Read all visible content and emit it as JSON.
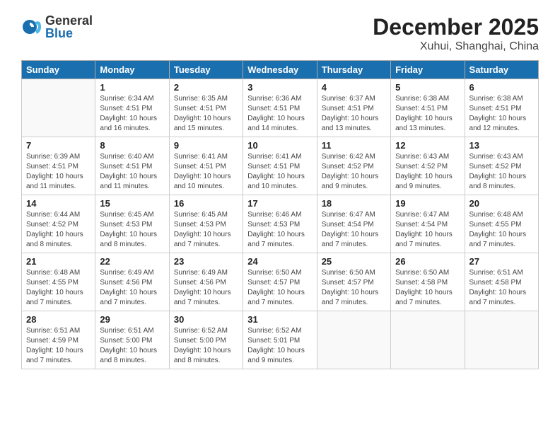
{
  "logo": {
    "general": "General",
    "blue": "Blue"
  },
  "title": "December 2025",
  "location": "Xuhui, Shanghai, China",
  "weekdays": [
    "Sunday",
    "Monday",
    "Tuesday",
    "Wednesday",
    "Thursday",
    "Friday",
    "Saturday"
  ],
  "weeks": [
    [
      {
        "day": "",
        "info": ""
      },
      {
        "day": "1",
        "info": "Sunrise: 6:34 AM\nSunset: 4:51 PM\nDaylight: 10 hours\nand 16 minutes."
      },
      {
        "day": "2",
        "info": "Sunrise: 6:35 AM\nSunset: 4:51 PM\nDaylight: 10 hours\nand 15 minutes."
      },
      {
        "day": "3",
        "info": "Sunrise: 6:36 AM\nSunset: 4:51 PM\nDaylight: 10 hours\nand 14 minutes."
      },
      {
        "day": "4",
        "info": "Sunrise: 6:37 AM\nSunset: 4:51 PM\nDaylight: 10 hours\nand 13 minutes."
      },
      {
        "day": "5",
        "info": "Sunrise: 6:38 AM\nSunset: 4:51 PM\nDaylight: 10 hours\nand 13 minutes."
      },
      {
        "day": "6",
        "info": "Sunrise: 6:38 AM\nSunset: 4:51 PM\nDaylight: 10 hours\nand 12 minutes."
      }
    ],
    [
      {
        "day": "7",
        "info": "Sunrise: 6:39 AM\nSunset: 4:51 PM\nDaylight: 10 hours\nand 11 minutes."
      },
      {
        "day": "8",
        "info": "Sunrise: 6:40 AM\nSunset: 4:51 PM\nDaylight: 10 hours\nand 11 minutes."
      },
      {
        "day": "9",
        "info": "Sunrise: 6:41 AM\nSunset: 4:51 PM\nDaylight: 10 hours\nand 10 minutes."
      },
      {
        "day": "10",
        "info": "Sunrise: 6:41 AM\nSunset: 4:51 PM\nDaylight: 10 hours\nand 10 minutes."
      },
      {
        "day": "11",
        "info": "Sunrise: 6:42 AM\nSunset: 4:52 PM\nDaylight: 10 hours\nand 9 minutes."
      },
      {
        "day": "12",
        "info": "Sunrise: 6:43 AM\nSunset: 4:52 PM\nDaylight: 10 hours\nand 9 minutes."
      },
      {
        "day": "13",
        "info": "Sunrise: 6:43 AM\nSunset: 4:52 PM\nDaylight: 10 hours\nand 8 minutes."
      }
    ],
    [
      {
        "day": "14",
        "info": "Sunrise: 6:44 AM\nSunset: 4:52 PM\nDaylight: 10 hours\nand 8 minutes."
      },
      {
        "day": "15",
        "info": "Sunrise: 6:45 AM\nSunset: 4:53 PM\nDaylight: 10 hours\nand 8 minutes."
      },
      {
        "day": "16",
        "info": "Sunrise: 6:45 AM\nSunset: 4:53 PM\nDaylight: 10 hours\nand 7 minutes."
      },
      {
        "day": "17",
        "info": "Sunrise: 6:46 AM\nSunset: 4:53 PM\nDaylight: 10 hours\nand 7 minutes."
      },
      {
        "day": "18",
        "info": "Sunrise: 6:47 AM\nSunset: 4:54 PM\nDaylight: 10 hours\nand 7 minutes."
      },
      {
        "day": "19",
        "info": "Sunrise: 6:47 AM\nSunset: 4:54 PM\nDaylight: 10 hours\nand 7 minutes."
      },
      {
        "day": "20",
        "info": "Sunrise: 6:48 AM\nSunset: 4:55 PM\nDaylight: 10 hours\nand 7 minutes."
      }
    ],
    [
      {
        "day": "21",
        "info": "Sunrise: 6:48 AM\nSunset: 4:55 PM\nDaylight: 10 hours\nand 7 minutes."
      },
      {
        "day": "22",
        "info": "Sunrise: 6:49 AM\nSunset: 4:56 PM\nDaylight: 10 hours\nand 7 minutes."
      },
      {
        "day": "23",
        "info": "Sunrise: 6:49 AM\nSunset: 4:56 PM\nDaylight: 10 hours\nand 7 minutes."
      },
      {
        "day": "24",
        "info": "Sunrise: 6:50 AM\nSunset: 4:57 PM\nDaylight: 10 hours\nand 7 minutes."
      },
      {
        "day": "25",
        "info": "Sunrise: 6:50 AM\nSunset: 4:57 PM\nDaylight: 10 hours\nand 7 minutes."
      },
      {
        "day": "26",
        "info": "Sunrise: 6:50 AM\nSunset: 4:58 PM\nDaylight: 10 hours\nand 7 minutes."
      },
      {
        "day": "27",
        "info": "Sunrise: 6:51 AM\nSunset: 4:58 PM\nDaylight: 10 hours\nand 7 minutes."
      }
    ],
    [
      {
        "day": "28",
        "info": "Sunrise: 6:51 AM\nSunset: 4:59 PM\nDaylight: 10 hours\nand 7 minutes."
      },
      {
        "day": "29",
        "info": "Sunrise: 6:51 AM\nSunset: 5:00 PM\nDaylight: 10 hours\nand 8 minutes."
      },
      {
        "day": "30",
        "info": "Sunrise: 6:52 AM\nSunset: 5:00 PM\nDaylight: 10 hours\nand 8 minutes."
      },
      {
        "day": "31",
        "info": "Sunrise: 6:52 AM\nSunset: 5:01 PM\nDaylight: 10 hours\nand 9 minutes."
      },
      {
        "day": "",
        "info": ""
      },
      {
        "day": "",
        "info": ""
      },
      {
        "day": "",
        "info": ""
      }
    ]
  ]
}
